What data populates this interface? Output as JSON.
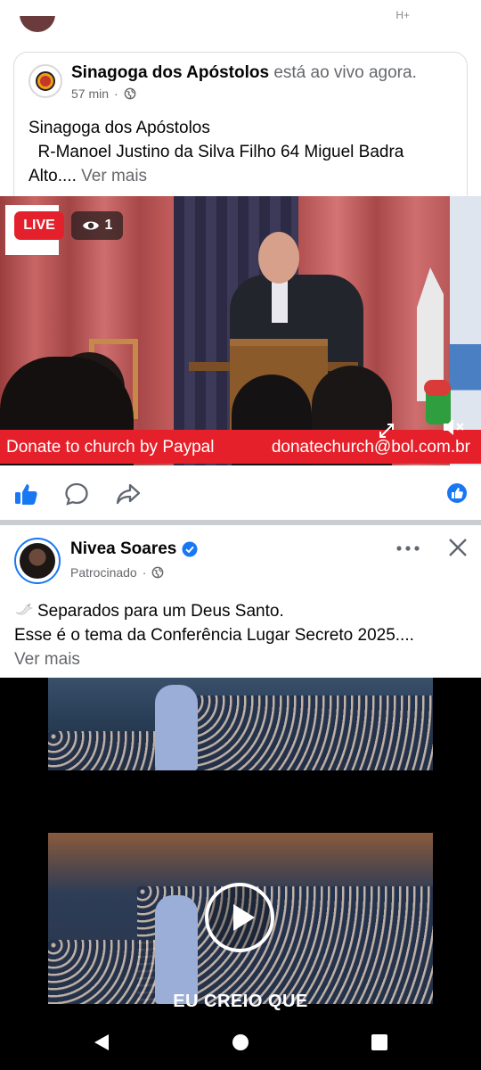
{
  "status_bar": {
    "network": "H+"
  },
  "shared_post": {
    "page_name": "Sinagoga dos Apóstolos",
    "status": "está ao vivo agora.",
    "time": "57 min",
    "separator": "·",
    "text_line1": "Sinagoga dos Apóstolos",
    "text_line2": "  R-Manoel Justino da Silva Filho 64 Miguel Badra",
    "text_line3": "Alto....",
    "see_more": "Ver mais"
  },
  "live_video": {
    "live_badge": "LIVE",
    "viewer_count": "1",
    "donate_left": "Donate to church by Paypal",
    "donate_right": "donatechurch@bol.com.br"
  },
  "actions": {
    "like_icon": "like-icon",
    "comment_icon": "comment-icon",
    "share_icon": "share-icon",
    "accent": "#1877f2"
  },
  "sponsored_post": {
    "author": "Nivea Soares",
    "label": "Patrocinado",
    "separator": "·",
    "text_line1": "Separados para um Deus Santo.",
    "text_line2": "Esse é o tema da Conferência Lugar Secreto 2025....",
    "see_more": "Ver mais",
    "video_caption": "EU CREIO QUE"
  },
  "colors": {
    "live_red": "#e4202c",
    "donate_red": "#e5202a",
    "muted_text": "#65676b",
    "divider": "#c9ccd1"
  }
}
